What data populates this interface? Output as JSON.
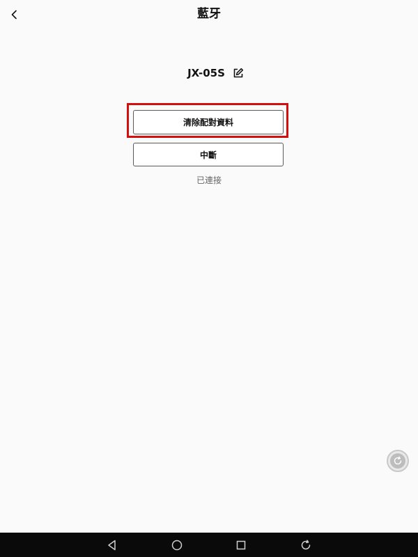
{
  "header": {
    "title": "藍牙",
    "back_icon": "chevron-left-icon"
  },
  "device": {
    "name": "JX-05S",
    "edit_icon": "edit-icon"
  },
  "actions": {
    "clear_pairing_label": "清除配對資料",
    "disconnect_label": "中斷"
  },
  "status": {
    "text": "已連接"
  },
  "fab": {
    "icon": "refresh-icon"
  },
  "navigation_bar": {
    "icons": [
      "nav-back-icon",
      "nav-home-icon",
      "nav-recents-icon",
      "rotate-icon"
    ]
  },
  "colors": {
    "background": "#fafafa",
    "highlight": "#d10f0f",
    "navbar": "#0a0a0a"
  }
}
